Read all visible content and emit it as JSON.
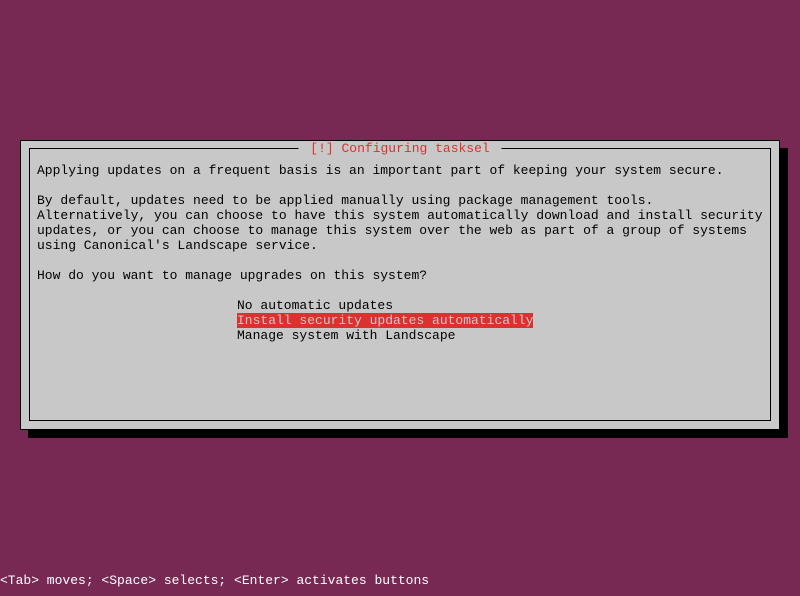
{
  "dialog": {
    "title": "[!] Configuring tasksel",
    "para1": "Applying updates on a frequent basis is an important part of keeping your system secure.",
    "para2": "By default, updates need to be applied manually using package management tools. Alternatively, you can choose to have this system automatically download and install security updates, or you can choose to manage this system over the web as part of a group of systems using Canonical's Landscape service.",
    "question": "How do you want to manage upgrades on this system?",
    "options": {
      "opt0": "No automatic updates",
      "opt1": "Install security updates automatically",
      "opt2": "Manage system with Landscape"
    }
  },
  "statusbar": "<Tab> moves; <Space> selects; <Enter> activates buttons"
}
